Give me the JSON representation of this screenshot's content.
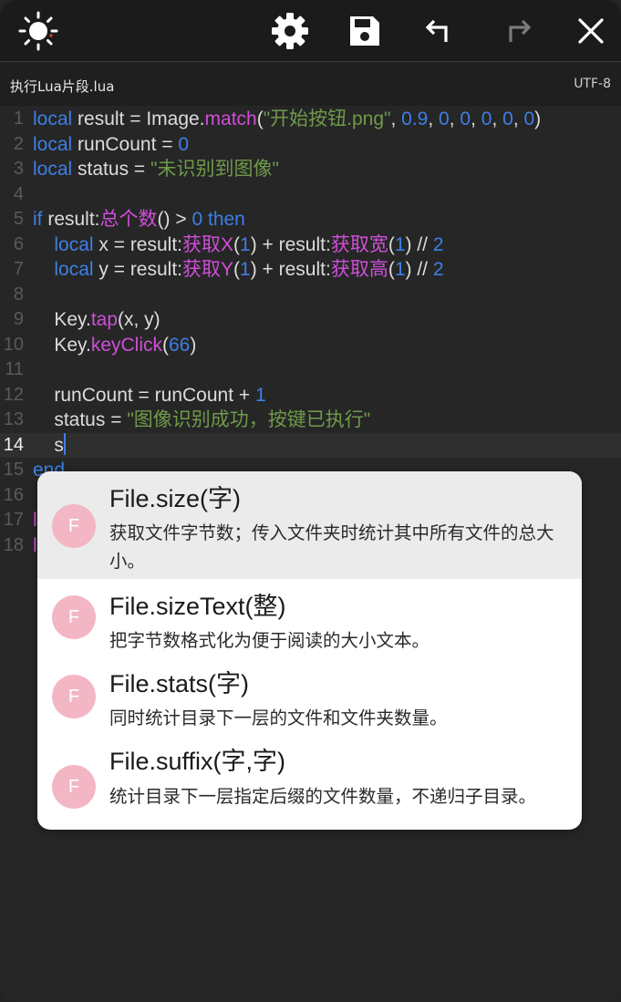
{
  "toolbar": {
    "icons": [
      "brightness-icon",
      "settings-icon",
      "save-icon",
      "undo-icon",
      "redo-icon",
      "close-icon"
    ]
  },
  "file": {
    "name": "执行Lua片段.lua",
    "encoding": "UTF-8"
  },
  "editor": {
    "current_line": 14,
    "lines": [
      {
        "n": "1",
        "segs": [
          [
            "kw",
            "local"
          ],
          [
            "t",
            " result = Image."
          ],
          [
            "fn",
            "match"
          ],
          [
            "t",
            "("
          ],
          [
            "str",
            "\"开始按钮.png\""
          ],
          [
            "t",
            ", "
          ],
          [
            "num",
            "0.9"
          ],
          [
            "t",
            ", "
          ],
          [
            "num",
            "0"
          ],
          [
            "t",
            ", "
          ],
          [
            "num",
            "0"
          ],
          [
            "t",
            ", "
          ],
          [
            "num",
            "0"
          ],
          [
            "t",
            ", "
          ],
          [
            "num",
            "0"
          ],
          [
            "t",
            ", "
          ],
          [
            "num",
            "0"
          ],
          [
            "t",
            ")"
          ]
        ]
      },
      {
        "n": "2",
        "segs": [
          [
            "kw",
            "local"
          ],
          [
            "t",
            " runCount = "
          ],
          [
            "num",
            "0"
          ]
        ]
      },
      {
        "n": "3",
        "segs": [
          [
            "kw",
            "local"
          ],
          [
            "t",
            " status = "
          ],
          [
            "str",
            "\"未识别到图像\""
          ]
        ]
      },
      {
        "n": "4",
        "segs": []
      },
      {
        "n": "5",
        "segs": [
          [
            "kw",
            "if"
          ],
          [
            "t",
            " result:"
          ],
          [
            "fn",
            "总个数"
          ],
          [
            "t",
            "() > "
          ],
          [
            "num",
            "0"
          ],
          [
            "t",
            " "
          ],
          [
            "kw",
            "then"
          ]
        ]
      },
      {
        "n": "6",
        "segs": [
          [
            "t",
            "    "
          ],
          [
            "kw",
            "local"
          ],
          [
            "t",
            " x = result:"
          ],
          [
            "fn",
            "获取X"
          ],
          [
            "t",
            "("
          ],
          [
            "num",
            "1"
          ],
          [
            "t",
            ") + result:"
          ],
          [
            "fn",
            "获取宽"
          ],
          [
            "t",
            "("
          ],
          [
            "num",
            "1"
          ],
          [
            "t",
            ") // "
          ],
          [
            "num",
            "2"
          ]
        ]
      },
      {
        "n": "7",
        "segs": [
          [
            "t",
            "    "
          ],
          [
            "kw",
            "local"
          ],
          [
            "t",
            " y = result:"
          ],
          [
            "fn",
            "获取Y"
          ],
          [
            "t",
            "("
          ],
          [
            "num",
            "1"
          ],
          [
            "t",
            ") + result:"
          ],
          [
            "fn",
            "获取高"
          ],
          [
            "t",
            "("
          ],
          [
            "num",
            "1"
          ],
          [
            "t",
            ") // "
          ],
          [
            "num",
            "2"
          ]
        ]
      },
      {
        "n": "8",
        "segs": []
      },
      {
        "n": "9",
        "segs": [
          [
            "t",
            "    Key."
          ],
          [
            "fn",
            "tap"
          ],
          [
            "t",
            "(x, y)"
          ]
        ]
      },
      {
        "n": "10",
        "segs": [
          [
            "t",
            "    Key."
          ],
          [
            "fn",
            "keyClick"
          ],
          [
            "t",
            "("
          ],
          [
            "num",
            "66"
          ],
          [
            "t",
            ")"
          ]
        ]
      },
      {
        "n": "11",
        "segs": []
      },
      {
        "n": "12",
        "segs": [
          [
            "t",
            "    runCount = runCount + "
          ],
          [
            "num",
            "1"
          ]
        ]
      },
      {
        "n": "13",
        "segs": [
          [
            "t",
            "    status = "
          ],
          [
            "str",
            "\"图像识别成功，按键已执行\""
          ]
        ]
      },
      {
        "n": "14",
        "segs": [
          [
            "t",
            "    s"
          ],
          [
            "cursor",
            ""
          ]
        ]
      },
      {
        "n": "15",
        "segs": [
          [
            "kw",
            "end"
          ]
        ]
      },
      {
        "n": "16",
        "segs": []
      },
      {
        "n": "17",
        "segs": [
          [
            "fn",
            "l"
          ]
        ]
      },
      {
        "n": "18",
        "segs": [
          [
            "fn",
            "l"
          ]
        ]
      }
    ]
  },
  "autocomplete": {
    "items": [
      {
        "badge": "F",
        "title": "File.size(字)",
        "desc": "获取文件字节数；传入文件夹时统计其中所有文件的总大小。",
        "selected": true
      },
      {
        "badge": "F",
        "title": "File.sizeText(整)",
        "desc": "把字节数格式化为便于阅读的大小文本。",
        "selected": false
      },
      {
        "badge": "F",
        "title": "File.stats(字)",
        "desc": "同时统计目录下一层的文件和文件夹数量。",
        "selected": false
      },
      {
        "badge": "F",
        "title": "File.suffix(字,字)",
        "desc": "统计目录下一层指定后缀的文件数量，不递归子目录。",
        "selected": false
      }
    ]
  },
  "colors": {
    "keyword": "#3d7fe6",
    "function": "#cf4fd8",
    "string": "#6e9a4a",
    "number": "#3d7fe6",
    "text": "#dcdcdc",
    "badge": "#f3b6c4",
    "background": "#262626"
  }
}
